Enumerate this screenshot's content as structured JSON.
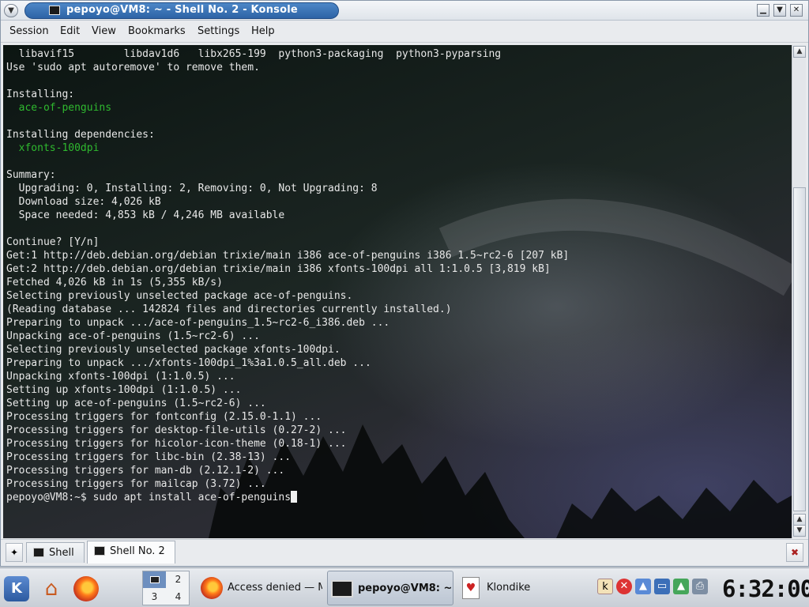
{
  "window": {
    "title": "pepoyo@VM8: ~ - Shell No. 2 - Konsole"
  },
  "menubar": {
    "items": [
      "Session",
      "Edit",
      "View",
      "Bookmarks",
      "Settings",
      "Help"
    ]
  },
  "terminal": {
    "lines": [
      "  libavif15        libdav1d6   libx265-199  python3-packaging  python3-pyparsing",
      "Use 'sudo apt autoremove' to remove them.",
      "",
      "Installing:",
      "  ace-of-penguins",
      "",
      "Installing dependencies:",
      "  xfonts-100dpi",
      "",
      "Summary:",
      "  Upgrading: 0, Installing: 2, Removing: 0, Not Upgrading: 8",
      "  Download size: 4,026 kB",
      "  Space needed: 4,853 kB / 4,246 MB available",
      "",
      "Continue? [Y/n]",
      "Get:1 http://deb.debian.org/debian trixie/main i386 ace-of-penguins i386 1.5~rc2-6 [207 kB]",
      "Get:2 http://deb.debian.org/debian trixie/main i386 xfonts-100dpi all 1:1.0.5 [3,819 kB]",
      "Fetched 4,026 kB in 1s (5,355 kB/s)",
      "Selecting previously unselected package ace-of-penguins.",
      "(Reading database ... 142824 files and directories currently installed.)",
      "Preparing to unpack .../ace-of-penguins_1.5~rc2-6_i386.deb ...",
      "Unpacking ace-of-penguins (1.5~rc2-6) ...",
      "Selecting previously unselected package xfonts-100dpi.",
      "Preparing to unpack .../xfonts-100dpi_1%3a1.0.5_all.deb ...",
      "Unpacking xfonts-100dpi (1:1.0.5) ...",
      "Setting up xfonts-100dpi (1:1.0.5) ...",
      "Setting up ace-of-penguins (1.5~rc2-6) ...",
      "Processing triggers for fontconfig (2.15.0-1.1) ...",
      "Processing triggers for desktop-file-utils (0.27-2) ...",
      "Processing triggers for hicolor-icon-theme (0.18-1) ...",
      "Processing triggers for libc-bin (2.38-13) ...",
      "Processing triggers for man-db (2.12.1-2) ...",
      "Processing triggers for mailcap (3.72) ..."
    ],
    "green_lines": [
      4,
      7
    ],
    "prompt": "pepoyo@VM8:~$ ",
    "command": "sudo apt install ace-of-penguins"
  },
  "tabs": [
    {
      "label": "Shell",
      "active": false
    },
    {
      "label": "Shell No. 2",
      "active": true
    }
  ],
  "pager": {
    "desktops": [
      "1",
      "2",
      "3",
      "4"
    ],
    "current": "1"
  },
  "taskbar": {
    "tasks": [
      {
        "label": "Access denied — M",
        "icon": "firefox-icon"
      },
      {
        "label": "pepoyo@VM8: ~",
        "icon": "terminal-icon"
      },
      {
        "label": "Klondike",
        "icon": "cards-icon"
      }
    ]
  },
  "tray": {
    "icons": [
      "klipper-icon",
      "network-disconnected-icon",
      "user-switch-icon",
      "display-icon",
      "update-icon",
      "printer-icon"
    ]
  },
  "clock": {
    "time": "6:32:00"
  },
  "colors": {
    "title_accent": "#3a72b8",
    "terminal_text": "#e8e8e8",
    "terminal_green": "#2fb92f"
  }
}
